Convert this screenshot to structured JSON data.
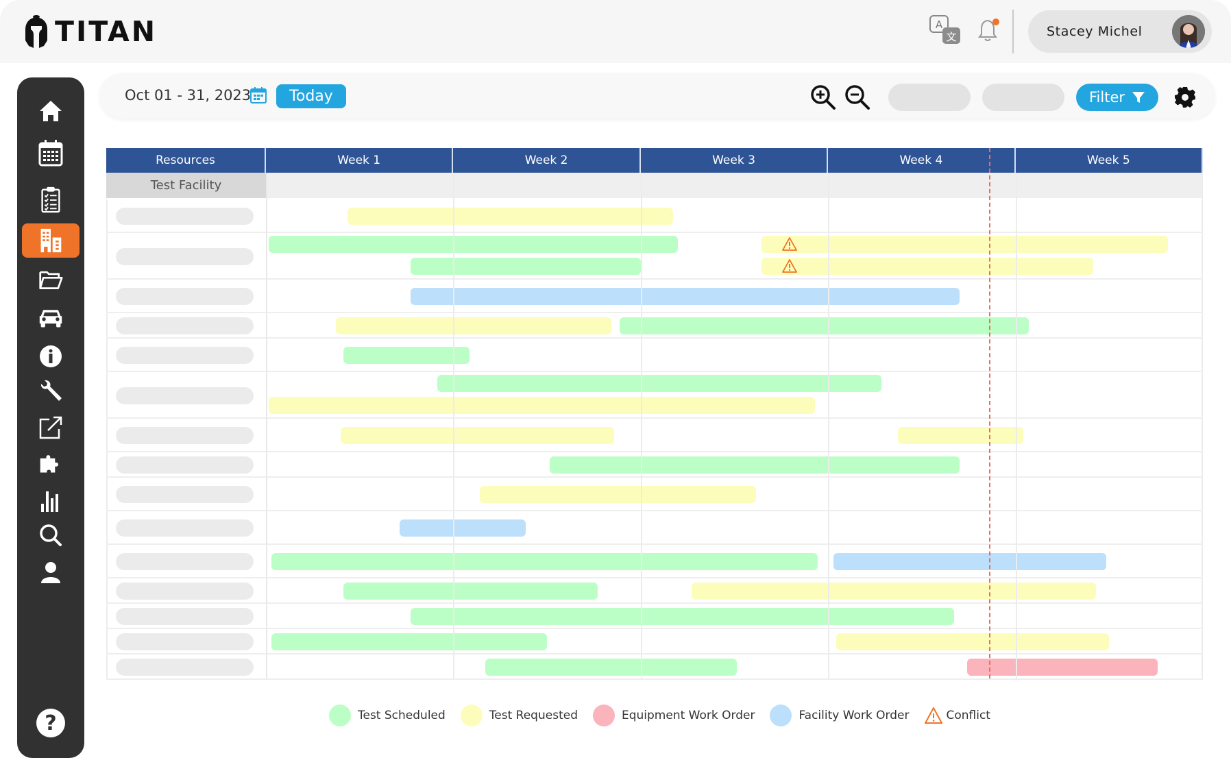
{
  "app": {
    "brand": "TITAN"
  },
  "header": {
    "icons": [
      "translate-icon",
      "bell-icon"
    ],
    "has_notification": true,
    "user_name": "Stacey Michel"
  },
  "sidebar": {
    "items": [
      {
        "name": "home",
        "icon": "home-icon",
        "active": false
      },
      {
        "name": "calendar",
        "icon": "calendar-icon",
        "active": false
      },
      {
        "name": "checklist",
        "icon": "clipboard-checklist-icon",
        "active": false
      },
      {
        "name": "facilities",
        "icon": "building-icon",
        "active": true
      },
      {
        "name": "folders",
        "icon": "folder-open-icon",
        "active": false
      },
      {
        "name": "vehicles",
        "icon": "car-icon",
        "active": false
      },
      {
        "name": "info",
        "icon": "info-icon",
        "active": false
      },
      {
        "name": "tools",
        "icon": "wrench-icon",
        "active": false
      },
      {
        "name": "external",
        "icon": "external-link-icon",
        "active": false
      },
      {
        "name": "plugins",
        "icon": "puzzle-icon",
        "active": false
      },
      {
        "name": "reports",
        "icon": "bar-chart-icon",
        "active": false
      },
      {
        "name": "search",
        "icon": "search-icon",
        "active": false
      },
      {
        "name": "profile",
        "icon": "user-icon",
        "active": false
      }
    ],
    "help_icon": "help-icon"
  },
  "toolbar": {
    "date_range": "Oct 01 - 31, 2023",
    "today_label": "Today",
    "filter_label": "Filter"
  },
  "colors": {
    "accent": "#23a5e0",
    "active_nav": "#ef7328",
    "header_blue": "#2f5496",
    "scheduled": "#bcffc6",
    "requested": "#fdfdbb",
    "equipment": "#fbb3bc",
    "facility": "#bcdffb",
    "conflict": "#ef7328",
    "today_line": "#e5705f"
  },
  "grid": {
    "resources_header": "Resources",
    "weeks": [
      "Week 1",
      "Week 2",
      "Week 3",
      "Week 4",
      "Week 5"
    ],
    "total_days": 35,
    "today_day": 27,
    "facility_label": "Test Facility",
    "rows": [
      {
        "lanes": 1,
        "bars": [
          {
            "type": "requested",
            "start": 3.05,
            "end": 15.2,
            "lane": 0
          }
        ]
      },
      {
        "lanes": 2,
        "bars": [
          {
            "type": "scheduled",
            "start": 0.1,
            "end": 15.4,
            "lane": 0
          },
          {
            "type": "requested",
            "start": 18.5,
            "end": 33.7,
            "lane": 0,
            "conflict": true
          },
          {
            "type": "scheduled",
            "start": 5.4,
            "end": 14.0,
            "lane": 1
          },
          {
            "type": "requested",
            "start": 18.5,
            "end": 30.9,
            "lane": 1,
            "conflict": true
          }
        ]
      },
      {
        "lanes": 1,
        "bars": [
          {
            "type": "facility",
            "start": 5.4,
            "end": 25.9,
            "lane": 0
          }
        ]
      },
      {
        "lanes": 1,
        "compact": true,
        "bars": [
          {
            "type": "requested",
            "start": 2.6,
            "end": 12.9,
            "lane": 0
          },
          {
            "type": "scheduled",
            "start": 13.2,
            "end": 28.5,
            "lane": 0
          }
        ]
      },
      {
        "lanes": 1,
        "bars": [
          {
            "type": "scheduled",
            "start": 2.9,
            "end": 7.6,
            "lane": 0
          }
        ]
      },
      {
        "lanes": 2,
        "bars": [
          {
            "type": "scheduled",
            "start": 6.4,
            "end": 23.0,
            "lane": 0
          },
          {
            "type": "requested",
            "start": 0.1,
            "end": 20.5,
            "lane": 1
          }
        ]
      },
      {
        "lanes": 1,
        "bars": [
          {
            "type": "requested",
            "start": 2.8,
            "end": 13.0,
            "lane": 0
          },
          {
            "type": "requested",
            "start": 23.6,
            "end": 28.3,
            "lane": 0
          }
        ]
      },
      {
        "lanes": 1,
        "compact": true,
        "bars": [
          {
            "type": "scheduled",
            "start": 10.6,
            "end": 25.9,
            "lane": 0
          }
        ]
      },
      {
        "lanes": 1,
        "bars": [
          {
            "type": "requested",
            "start": 8.0,
            "end": 18.3,
            "lane": 0
          }
        ]
      },
      {
        "lanes": 1,
        "bars": [
          {
            "type": "facility",
            "start": 5.0,
            "end": 9.7,
            "lane": 0
          }
        ]
      },
      {
        "lanes": 1,
        "bars": [
          {
            "type": "scheduled",
            "start": 0.2,
            "end": 20.6,
            "lane": 0
          },
          {
            "type": "facility",
            "start": 21.2,
            "end": 31.4,
            "lane": 0
          }
        ]
      },
      {
        "lanes": 1,
        "compact": true,
        "bars": [
          {
            "type": "scheduled",
            "start": 2.9,
            "end": 12.4,
            "lane": 0
          },
          {
            "type": "requested",
            "start": 15.9,
            "end": 31.0,
            "lane": 0
          }
        ]
      },
      {
        "lanes": 1,
        "compact": true,
        "bars": [
          {
            "type": "scheduled",
            "start": 5.4,
            "end": 25.7,
            "lane": 0
          }
        ]
      },
      {
        "lanes": 1,
        "compact": true,
        "bars": [
          {
            "type": "scheduled",
            "start": 0.2,
            "end": 10.5,
            "lane": 0
          },
          {
            "type": "requested",
            "start": 21.3,
            "end": 31.5,
            "lane": 0
          }
        ]
      },
      {
        "lanes": 1,
        "compact": true,
        "bars": [
          {
            "type": "scheduled",
            "start": 8.2,
            "end": 17.6,
            "lane": 0
          },
          {
            "type": "equipment",
            "start": 26.2,
            "end": 33.3,
            "lane": 0
          }
        ]
      }
    ]
  },
  "legend": [
    {
      "key": "scheduled",
      "label": "Test Scheduled"
    },
    {
      "key": "requested",
      "label": "Test Requested"
    },
    {
      "key": "equipment",
      "label": "Equipment Work Order"
    },
    {
      "key": "facility",
      "label": "Facility Work Order"
    },
    {
      "key": "conflict",
      "label": "Conflict"
    }
  ]
}
